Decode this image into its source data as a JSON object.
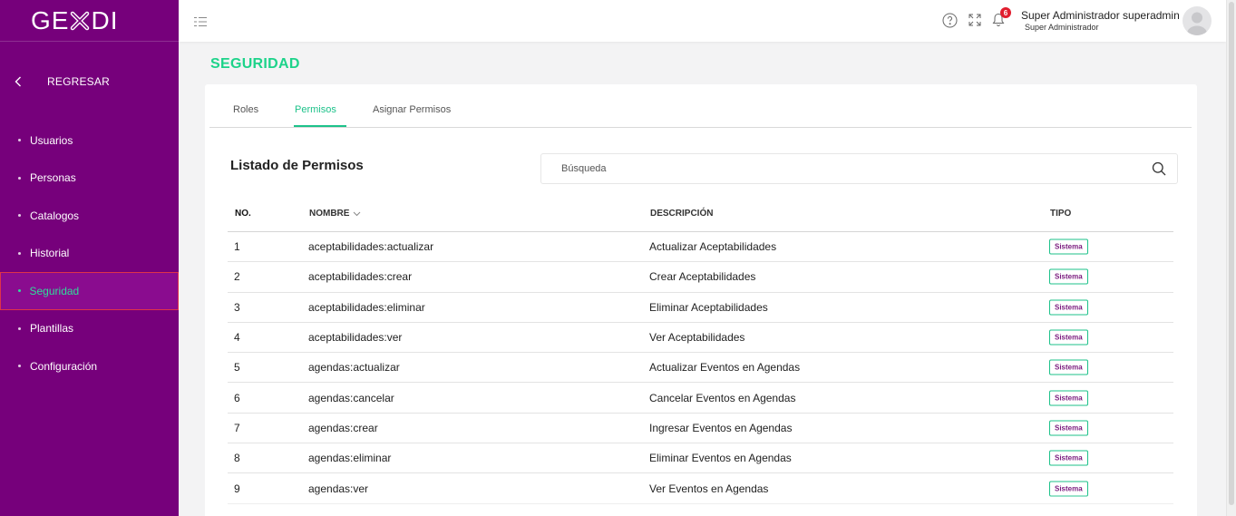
{
  "app": {
    "logo_left": "GE",
    "logo_right": "DI",
    "colors": {
      "sidebar": "#76007b",
      "accent": "#1dd38a",
      "badge": "#e11d2e"
    }
  },
  "sidebar": {
    "back_label": "REGRESAR",
    "items": [
      {
        "label": "Usuarios",
        "active": false
      },
      {
        "label": "Personas",
        "active": false
      },
      {
        "label": "Catalogos",
        "active": false
      },
      {
        "label": "Historial",
        "active": false
      },
      {
        "label": "Seguridad",
        "active": true
      },
      {
        "label": "Plantillas",
        "active": false
      },
      {
        "label": "Configuración",
        "active": false
      }
    ]
  },
  "header": {
    "icons": [
      "menu-icon",
      "help-icon",
      "fullscreen-icon",
      "bell-icon"
    ],
    "notification_count": "6",
    "user_name": "Super Administrador superadmin",
    "user_role": "Super Administrador"
  },
  "page": {
    "title": "SEGURIDAD",
    "tabs": [
      {
        "label": "Roles",
        "active": false
      },
      {
        "label": "Permisos",
        "active": true
      },
      {
        "label": "Asignar Permisos",
        "active": false
      }
    ],
    "list_title": "Listado de Permisos",
    "search": {
      "placeholder": "Búsqueda",
      "value": ""
    }
  },
  "table": {
    "columns": [
      "NO.",
      "NOMBRE",
      "DESCRIPCIÓN",
      "TIPO"
    ],
    "rows": [
      {
        "no": "1",
        "nombre": "aceptabilidades:actualizar",
        "descripcion": "Actualizar Aceptabilidades",
        "tipo": "Sistema"
      },
      {
        "no": "2",
        "nombre": "aceptabilidades:crear",
        "descripcion": "Crear Aceptabilidades",
        "tipo": "Sistema"
      },
      {
        "no": "3",
        "nombre": "aceptabilidades:eliminar",
        "descripcion": "Eliminar Aceptabilidades",
        "tipo": "Sistema"
      },
      {
        "no": "4",
        "nombre": "aceptabilidades:ver",
        "descripcion": "Ver Aceptabilidades",
        "tipo": "Sistema"
      },
      {
        "no": "5",
        "nombre": "agendas:actualizar",
        "descripcion": "Actualizar Eventos en Agendas",
        "tipo": "Sistema"
      },
      {
        "no": "6",
        "nombre": "agendas:cancelar",
        "descripcion": "Cancelar Eventos en Agendas",
        "tipo": "Sistema"
      },
      {
        "no": "7",
        "nombre": "agendas:crear",
        "descripcion": "Ingresar Eventos en Agendas",
        "tipo": "Sistema"
      },
      {
        "no": "8",
        "nombre": "agendas:eliminar",
        "descripcion": "Eliminar Eventos en Agendas",
        "tipo": "Sistema"
      },
      {
        "no": "9",
        "nombre": "agendas:ver",
        "descripcion": "Ver Eventos en Agendas",
        "tipo": "Sistema"
      }
    ]
  }
}
